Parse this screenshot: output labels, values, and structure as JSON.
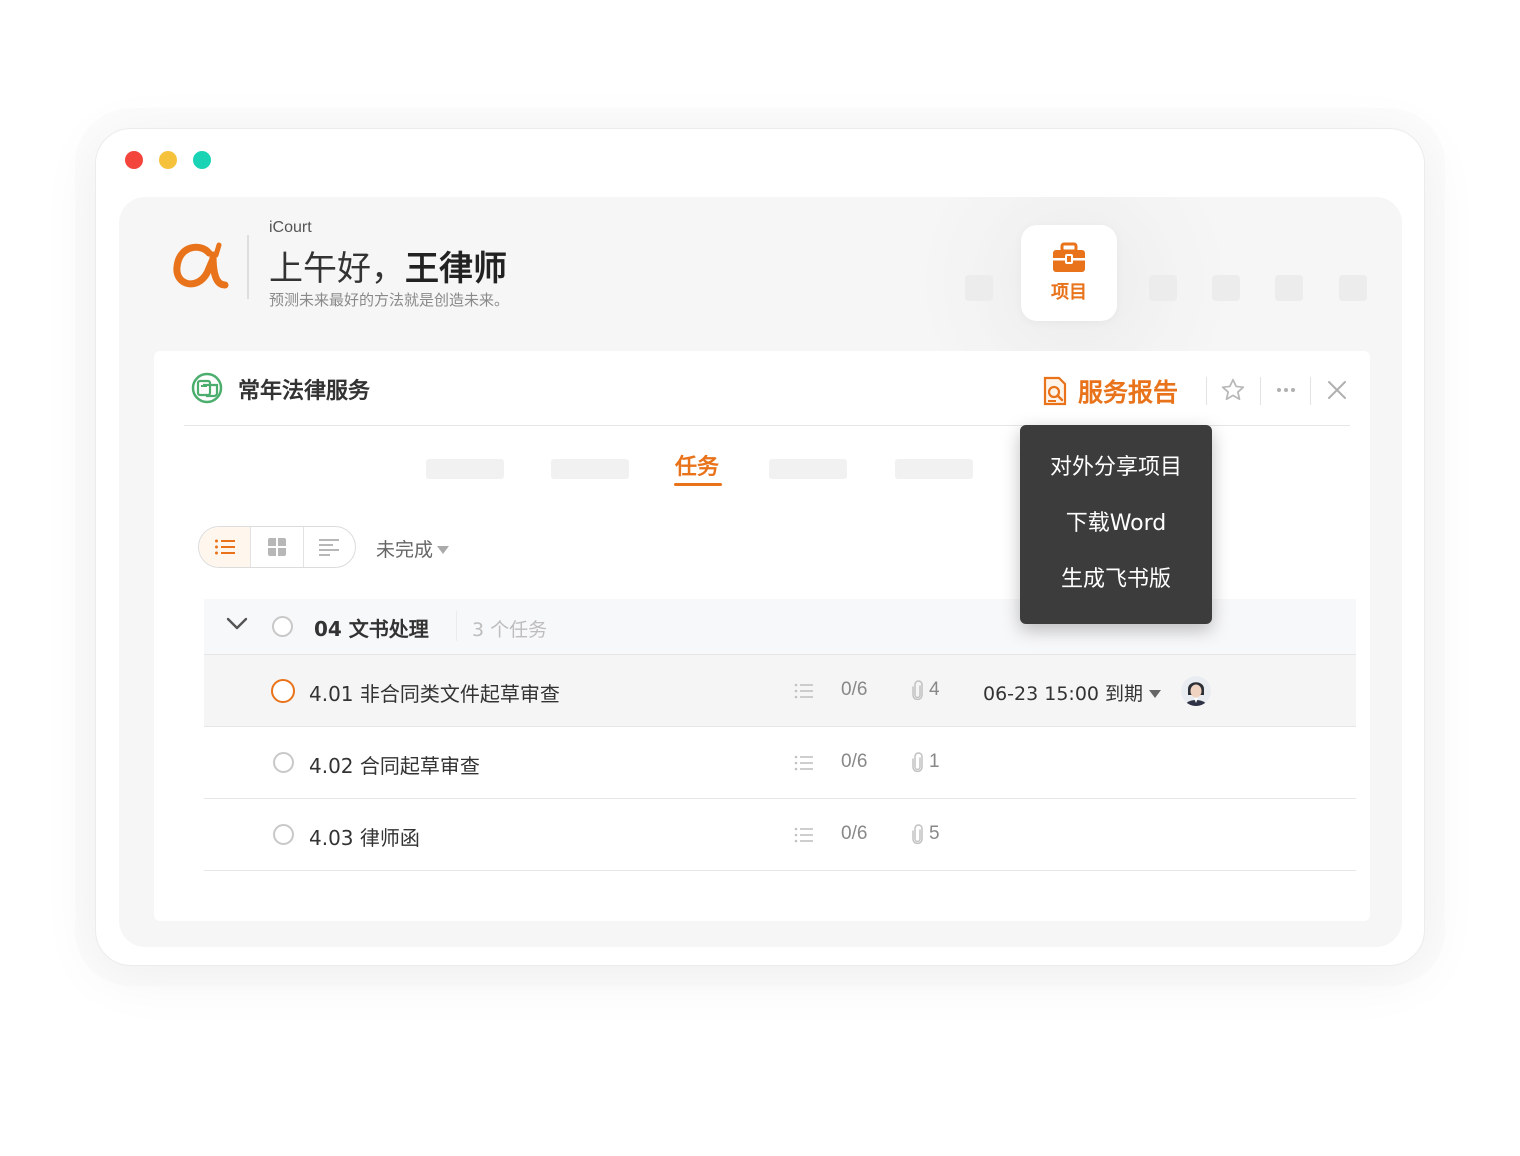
{
  "window": {
    "traffic_lights": [
      {
        "name": "close",
        "color": "#f4453c"
      },
      {
        "name": "minimize",
        "color": "#f6c23b"
      },
      {
        "name": "maximize",
        "color": "#19d4b4"
      }
    ]
  },
  "header": {
    "brand": "iCourt",
    "greeting_prefix": "上午好，",
    "greeting_name": "王律师",
    "motto": "预测未来最好的方法就是创造未来。",
    "project_button_label": "项目",
    "accent_color": "#e8731a",
    "logo_icon": "icourt-alpha-logo"
  },
  "project": {
    "title": "常年法律服务",
    "icon": "legal-service-icon",
    "report_label": "服务报告",
    "actions": [
      "star-icon",
      "more-icon",
      "close-icon"
    ]
  },
  "tabs": {
    "active_label": "任务"
  },
  "toolbar": {
    "views": [
      "list-view-icon",
      "board-view-icon",
      "outline-view-icon"
    ],
    "active_view": "list-view-icon",
    "filter_label": "未完成"
  },
  "task_group": {
    "name": "04 文书处理",
    "count_label": "3 个任务"
  },
  "tasks": [
    {
      "title": "4.01 非合同类文件起草审查",
      "subtasks": "0/6",
      "attachments": "4",
      "due": "06-23 15:00 到期",
      "has_avatar": true
    },
    {
      "title": "4.02 合同起草审查",
      "subtasks": "0/6",
      "attachments": "1"
    },
    {
      "title": "4.03 律师函",
      "subtasks": "0/6",
      "attachments": "5"
    }
  ],
  "report_menu": {
    "items": [
      "对外分享项目",
      "下载Word",
      "生成飞书版"
    ]
  }
}
